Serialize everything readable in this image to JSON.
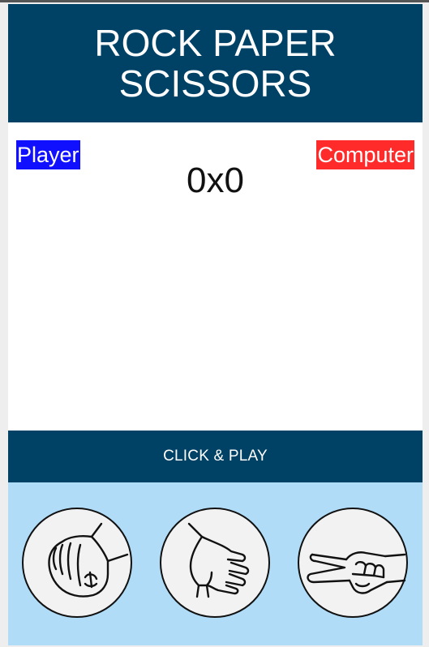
{
  "header": {
    "title": "ROCK PAPER SCISSORS"
  },
  "scoreboard": {
    "player_label": "Player",
    "computer_label": "Computer",
    "score": "0x0"
  },
  "play_bar": {
    "label": "CLICK & PLAY"
  },
  "choices": [
    {
      "id": "rock",
      "icon": "rock-hand-icon"
    },
    {
      "id": "paper",
      "icon": "paper-hand-icon"
    },
    {
      "id": "scissors",
      "icon": "scissors-hand-icon"
    }
  ],
  "colors": {
    "header_bg": "#004166",
    "player": "#1010ff",
    "computer": "#ff2b2b",
    "choices_bg": "#b0dcf7"
  }
}
